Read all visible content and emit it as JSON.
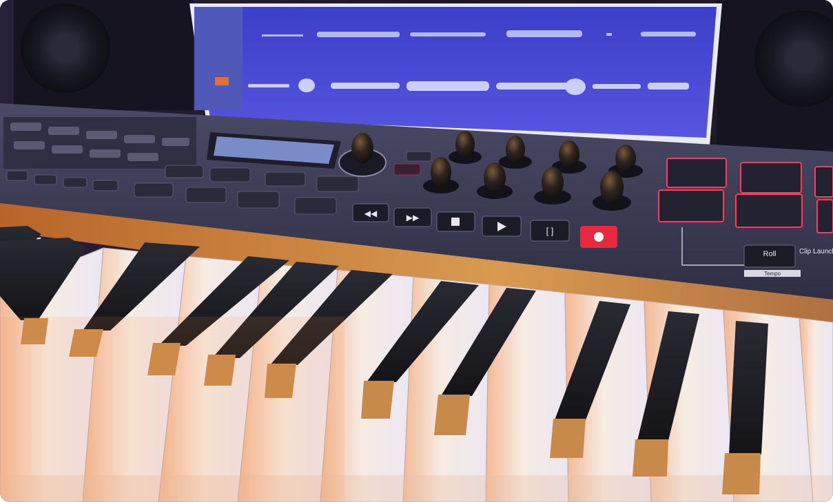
{
  "photo": {
    "subject": "MIDI keyboard controller with piano keys, pads, knobs and transport controls in front of a DAW screen and studio monitors",
    "colors": {
      "background": "#1a1530",
      "screen": "#4a4ad8",
      "controller_body": "#3a3a52",
      "wood_trim": "#c9823e",
      "white_key": "#f4efe8",
      "black_key": "#1c1c24",
      "pad_glow": "#ff3a5a",
      "record_button": "#e8283c"
    }
  },
  "controller": {
    "pad_labels": {
      "roll": "Roll",
      "clip_launch": "Clip Launch",
      "tempo": "Tempo"
    },
    "transport_icons": [
      "rewind-icon",
      "fast-forward-icon",
      "stop-icon",
      "play-icon",
      "loop-icon",
      "record-icon"
    ]
  }
}
